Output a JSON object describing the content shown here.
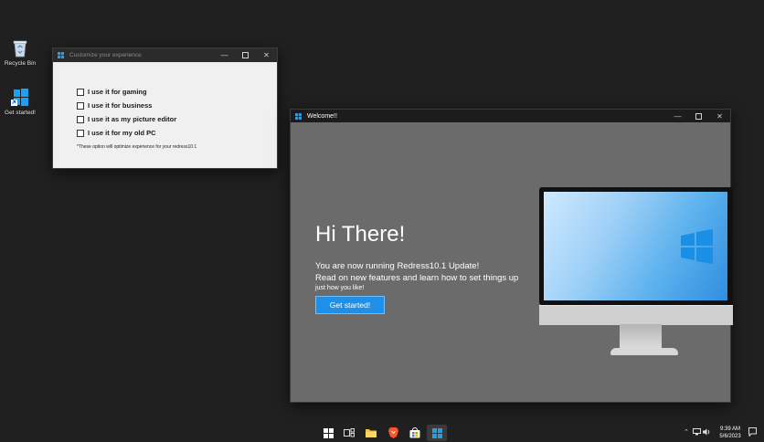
{
  "desktop": {
    "icons": [
      {
        "label": "Recycle Bin",
        "icon": "recycle-bin-icon"
      },
      {
        "label": "Get started!",
        "icon": "windows-logo-icon"
      }
    ]
  },
  "customize_window": {
    "title": "Customize your experience",
    "options": [
      {
        "label": "I use it for gaming",
        "checked": false
      },
      {
        "label": "I use it for business",
        "checked": false
      },
      {
        "label": "I use it as my picture editor",
        "checked": false
      },
      {
        "label": "I use it for my old PC",
        "checked": false
      }
    ],
    "note": "*These option will optimize experience for your redress10.1"
  },
  "welcome_window": {
    "title": "Welcome!!",
    "heading": "Hi There!",
    "line1": "You are now running Redress10.1 Update!",
    "line2": "Read on new features and learn how to set things up",
    "line3": "just how you like!",
    "button_label": "Get started!"
  },
  "taskbar": {
    "items": [
      "start-icon",
      "task-view-icon",
      "file-explorer-icon",
      "brave-browser-icon",
      "store-icon",
      "welcome-app-icon"
    ],
    "clock_time": "9:39 AM",
    "clock_date": "5/6/2023"
  },
  "colors": {
    "desktop_bg": "#202020",
    "accent": "#1f8fe8",
    "welcome_bg": "#6b6b6b"
  }
}
